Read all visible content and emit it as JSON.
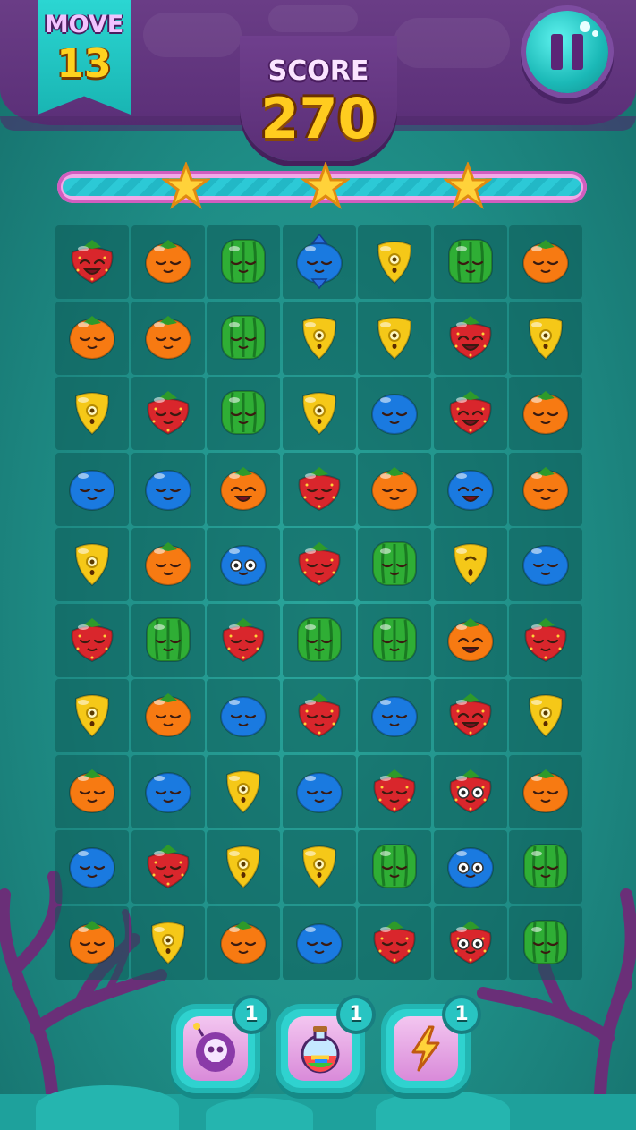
{
  "hud": {
    "move_label": "MOVE",
    "move_value": "13",
    "score_label": "SCORE",
    "score_value": "270",
    "progress_fraction": 1.0,
    "stars_earned": 3
  },
  "board": {
    "rows": 10,
    "cols": 7,
    "grid": [
      [
        "strawberry-happy",
        "orange",
        "watermelon",
        "blueberry-striped",
        "lemon",
        "watermelon",
        "orange"
      ],
      [
        "orange",
        "orange",
        "watermelon",
        "lemon",
        "lemon",
        "strawberry-happy",
        "lemon"
      ],
      [
        "lemon",
        "strawberry",
        "watermelon",
        "lemon",
        "blueberry",
        "strawberry-happy",
        "orange"
      ],
      [
        "blueberry",
        "blueberry",
        "orange-happy",
        "strawberry",
        "orange",
        "blueberry-happy",
        "orange"
      ],
      [
        "lemon",
        "orange",
        "blueberry-eyes",
        "strawberry",
        "watermelon",
        "lemon-happy",
        "blueberry"
      ],
      [
        "strawberry",
        "watermelon",
        "strawberry",
        "watermelon",
        "watermelon",
        "orange-happy",
        "strawberry"
      ],
      [
        "lemon",
        "orange",
        "blueberry",
        "strawberry",
        "blueberry",
        "strawberry-happy",
        "lemon"
      ],
      [
        "orange",
        "blueberry",
        "lemon",
        "blueberry",
        "strawberry",
        "strawberry-eyes",
        "orange"
      ],
      [
        "blueberry",
        "strawberry",
        "lemon",
        "lemon",
        "watermelon",
        "blueberry-eyes",
        "watermelon"
      ],
      [
        "orange",
        "lemon",
        "orange",
        "blueberry",
        "strawberry",
        "strawberry-eyes",
        "watermelon"
      ]
    ]
  },
  "boosters": [
    {
      "icon": "skull-bomb-icon",
      "count": "1"
    },
    {
      "icon": "rainbow-potion-icon",
      "count": "1"
    },
    {
      "icon": "lightning-icon",
      "count": "1"
    }
  ],
  "colors": {
    "strawberry": "#d9262c",
    "orange": "#f77a12",
    "watermelon": "#2fae35",
    "blueberry": "#1a7ae0",
    "lemon": "#f5c818",
    "board_bg": "#1f8f88",
    "banner": "#5b2f78"
  }
}
